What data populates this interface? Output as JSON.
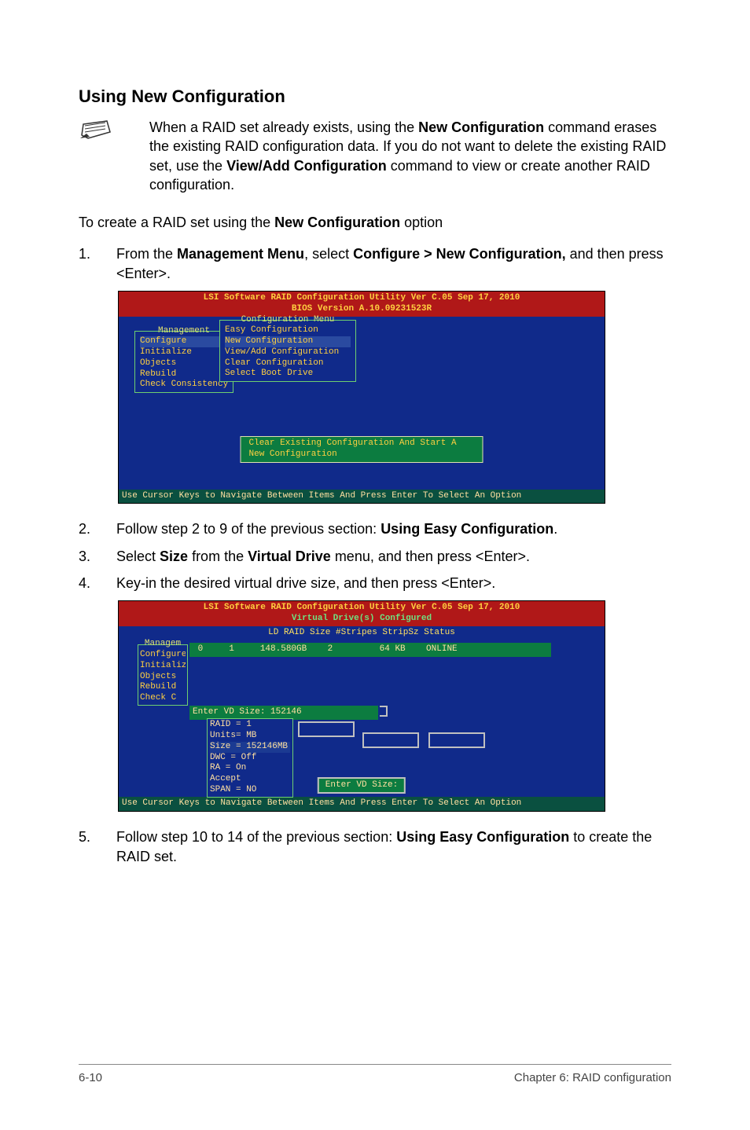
{
  "heading": "Using New Configuration",
  "note": {
    "t1": "When a RAID set already exists, using the ",
    "b1": "New Configuration",
    "t2": " command erases the existing RAID configuration data. If you do not want to delete the existing RAID set, use the ",
    "b2": "View/Add Configuration",
    "t3": " command to view or create another RAID configuration."
  },
  "intro": {
    "t1": "To create a RAID set using the ",
    "b1": "New Configuration",
    "t2": " option"
  },
  "step1": {
    "num": "1.",
    "t1": "From the ",
    "b1": "Management Menu",
    "t2": ", select ",
    "b2": "Configure > New Configuration,",
    "t3": " and then press <Enter>."
  },
  "bios1": {
    "title1": "LSI Software RAID Configuration Utility Ver C.05 Sep 17, 2010",
    "title2": "BIOS Version   A.10.09231523R",
    "mgmt_label": "Management",
    "mgmt_items": [
      "Configure",
      "Initialize",
      "Objects",
      "Rebuild",
      "Check Consistency"
    ],
    "cfg_label": "Configuration Menu",
    "cfg_items": [
      "Easy Configuration",
      "New Configuration",
      "View/Add Configuration",
      "Clear Configuration",
      "Select Boot Drive"
    ],
    "status": "Clear Existing Configuration And Start A New Configuration",
    "footer": "Use Cursor Keys to Navigate Between Items And Press Enter To Select An Option"
  },
  "step2": {
    "num": "2.",
    "t1": "Follow step 2 to 9 of the previous section: ",
    "b1": "Using Easy Configuration",
    "t2": "."
  },
  "step3": {
    "num": "3.",
    "t1": "Select ",
    "b1": "Size",
    "t2": " from the ",
    "b2": "Virtual Drive",
    "t3": " menu, and then press <Enter>."
  },
  "step4": {
    "num": "4.",
    "t1": "Key-in the desired virtual drive size, and then press <Enter>."
  },
  "bios2": {
    "title1": "LSI Software RAID Configuration Utility Ver C.05 Sep 17, 2010",
    "subtitle": "Virtual Drive(s) Configured",
    "cols": "LD    RAID     Size     #Stripes    StripSz    Status",
    "side_label": "Managem",
    "side_items": [
      "Configure",
      "Initializ",
      "Objects",
      "Rebuild",
      "Check C"
    ],
    "datarow": " 0     1     148.580GB    2         64 KB    ONLINE",
    "vd_label": "Enter VD Size: 152146",
    "lil": [
      "RAID = 1",
      "Units= MB",
      "Size = 152146MB",
      "DWC  = Off",
      "RA   = On",
      "Accept",
      "SPAN = NO"
    ],
    "enter_label": "Enter VD Size:",
    "footer": "Use Cursor Keys to Navigate Between Items And Press Enter To Select An Option"
  },
  "step5": {
    "num": "5.",
    "t1": "Follow step 10 to 14 of the previous section: ",
    "b1": "Using Easy Configuration",
    "t2": " to create the RAID set."
  },
  "footer": {
    "left": "6-10",
    "right": "Chapter 6: RAID configuration"
  }
}
